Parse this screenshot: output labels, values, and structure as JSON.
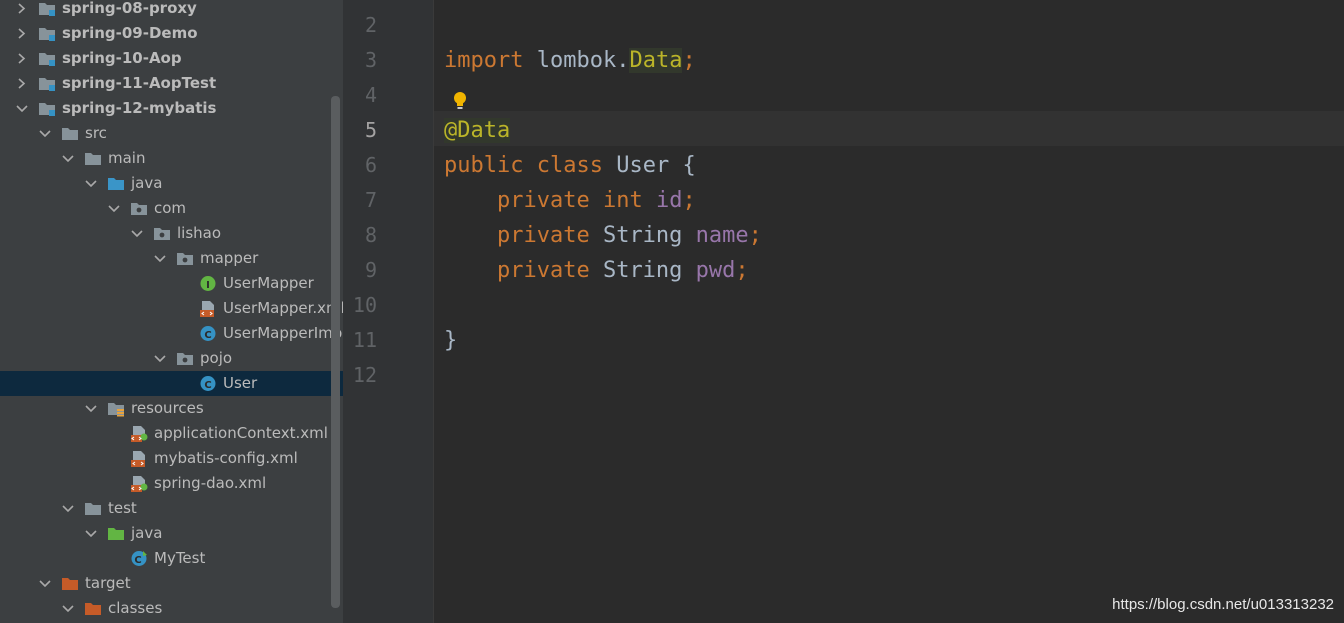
{
  "project_tree": [
    {
      "label": "spring-08-proxy",
      "depth": 0,
      "arrow": "right",
      "icon": "module-folder-icon",
      "bold": true
    },
    {
      "label": "spring-09-Demo",
      "depth": 0,
      "arrow": "right",
      "icon": "module-folder-icon",
      "bold": true
    },
    {
      "label": "spring-10-Aop",
      "depth": 0,
      "arrow": "right",
      "icon": "module-folder-icon",
      "bold": true
    },
    {
      "label": "spring-11-AopTest",
      "depth": 0,
      "arrow": "right",
      "icon": "module-folder-icon",
      "bold": true
    },
    {
      "label": "spring-12-mybatis",
      "depth": 0,
      "arrow": "down",
      "icon": "module-folder-icon",
      "bold": true
    },
    {
      "label": "src",
      "depth": 1,
      "arrow": "down",
      "icon": "folder-icon"
    },
    {
      "label": "main",
      "depth": 2,
      "arrow": "down",
      "icon": "folder-icon"
    },
    {
      "label": "java",
      "depth": 3,
      "arrow": "down",
      "icon": "source-folder-icon"
    },
    {
      "label": "com",
      "depth": 4,
      "arrow": "down",
      "icon": "package-icon"
    },
    {
      "label": "lishao",
      "depth": 5,
      "arrow": "down",
      "icon": "package-icon"
    },
    {
      "label": "mapper",
      "depth": 6,
      "arrow": "down",
      "icon": "package-icon"
    },
    {
      "label": "UserMapper",
      "depth": 7,
      "arrow": "none",
      "icon": "interface-icon"
    },
    {
      "label": "UserMapper.xml",
      "depth": 7,
      "arrow": "none",
      "icon": "xml-file-icon"
    },
    {
      "label": "UserMapperImpl",
      "depth": 7,
      "arrow": "none",
      "icon": "class-icon"
    },
    {
      "label": "pojo",
      "depth": 6,
      "arrow": "down",
      "icon": "package-icon"
    },
    {
      "label": "User",
      "depth": 7,
      "arrow": "none",
      "icon": "class-icon",
      "selected": true
    },
    {
      "label": "resources",
      "depth": 3,
      "arrow": "down",
      "icon": "resources-folder-icon"
    },
    {
      "label": "applicationContext.xml",
      "depth": 4,
      "arrow": "none",
      "icon": "spring-xml-icon"
    },
    {
      "label": "mybatis-config.xml",
      "depth": 4,
      "arrow": "none",
      "icon": "xml-file-icon"
    },
    {
      "label": "spring-dao.xml",
      "depth": 4,
      "arrow": "none",
      "icon": "spring-xml-icon"
    },
    {
      "label": "test",
      "depth": 2,
      "arrow": "down",
      "icon": "folder-icon"
    },
    {
      "label": "java",
      "depth": 3,
      "arrow": "down",
      "icon": "test-folder-icon"
    },
    {
      "label": "MyTest",
      "depth": 4,
      "arrow": "none",
      "icon": "test-class-icon"
    },
    {
      "label": "target",
      "depth": 1,
      "arrow": "down",
      "icon": "excluded-folder-icon"
    },
    {
      "label": "classes",
      "depth": 2,
      "arrow": "down",
      "icon": "excluded-folder-icon"
    }
  ],
  "editor": {
    "line_numbers": [
      "2",
      "3",
      "4",
      "5",
      "6",
      "7",
      "8",
      "9",
      "10",
      "11",
      "12"
    ],
    "current_line": "5",
    "code": {
      "l3_import": "import",
      "l3_pkg": " lombok.",
      "l3_data": "Data",
      "l3_semi": ";",
      "l5_annotation": "@Data",
      "l6_public": "public",
      "l6_class": "class",
      "l6_name": " User {",
      "l7_private": "private",
      "l7_int": "int",
      "l7_field": "id",
      "l7_semi": ";",
      "l8_private": "private",
      "l8_type": " String ",
      "l8_field": "name",
      "l8_semi": ";",
      "l9_private": "private",
      "l9_type": " String ",
      "l9_field": "pwd",
      "l9_semi": ";",
      "l11_brace": "}"
    },
    "colors": {
      "keyword": "#cc7832",
      "field": "#9876aa",
      "annotation": "#bbb529",
      "text": "#a9b7c6"
    }
  },
  "watermark": "https://blog.csdn.net/u013313232"
}
